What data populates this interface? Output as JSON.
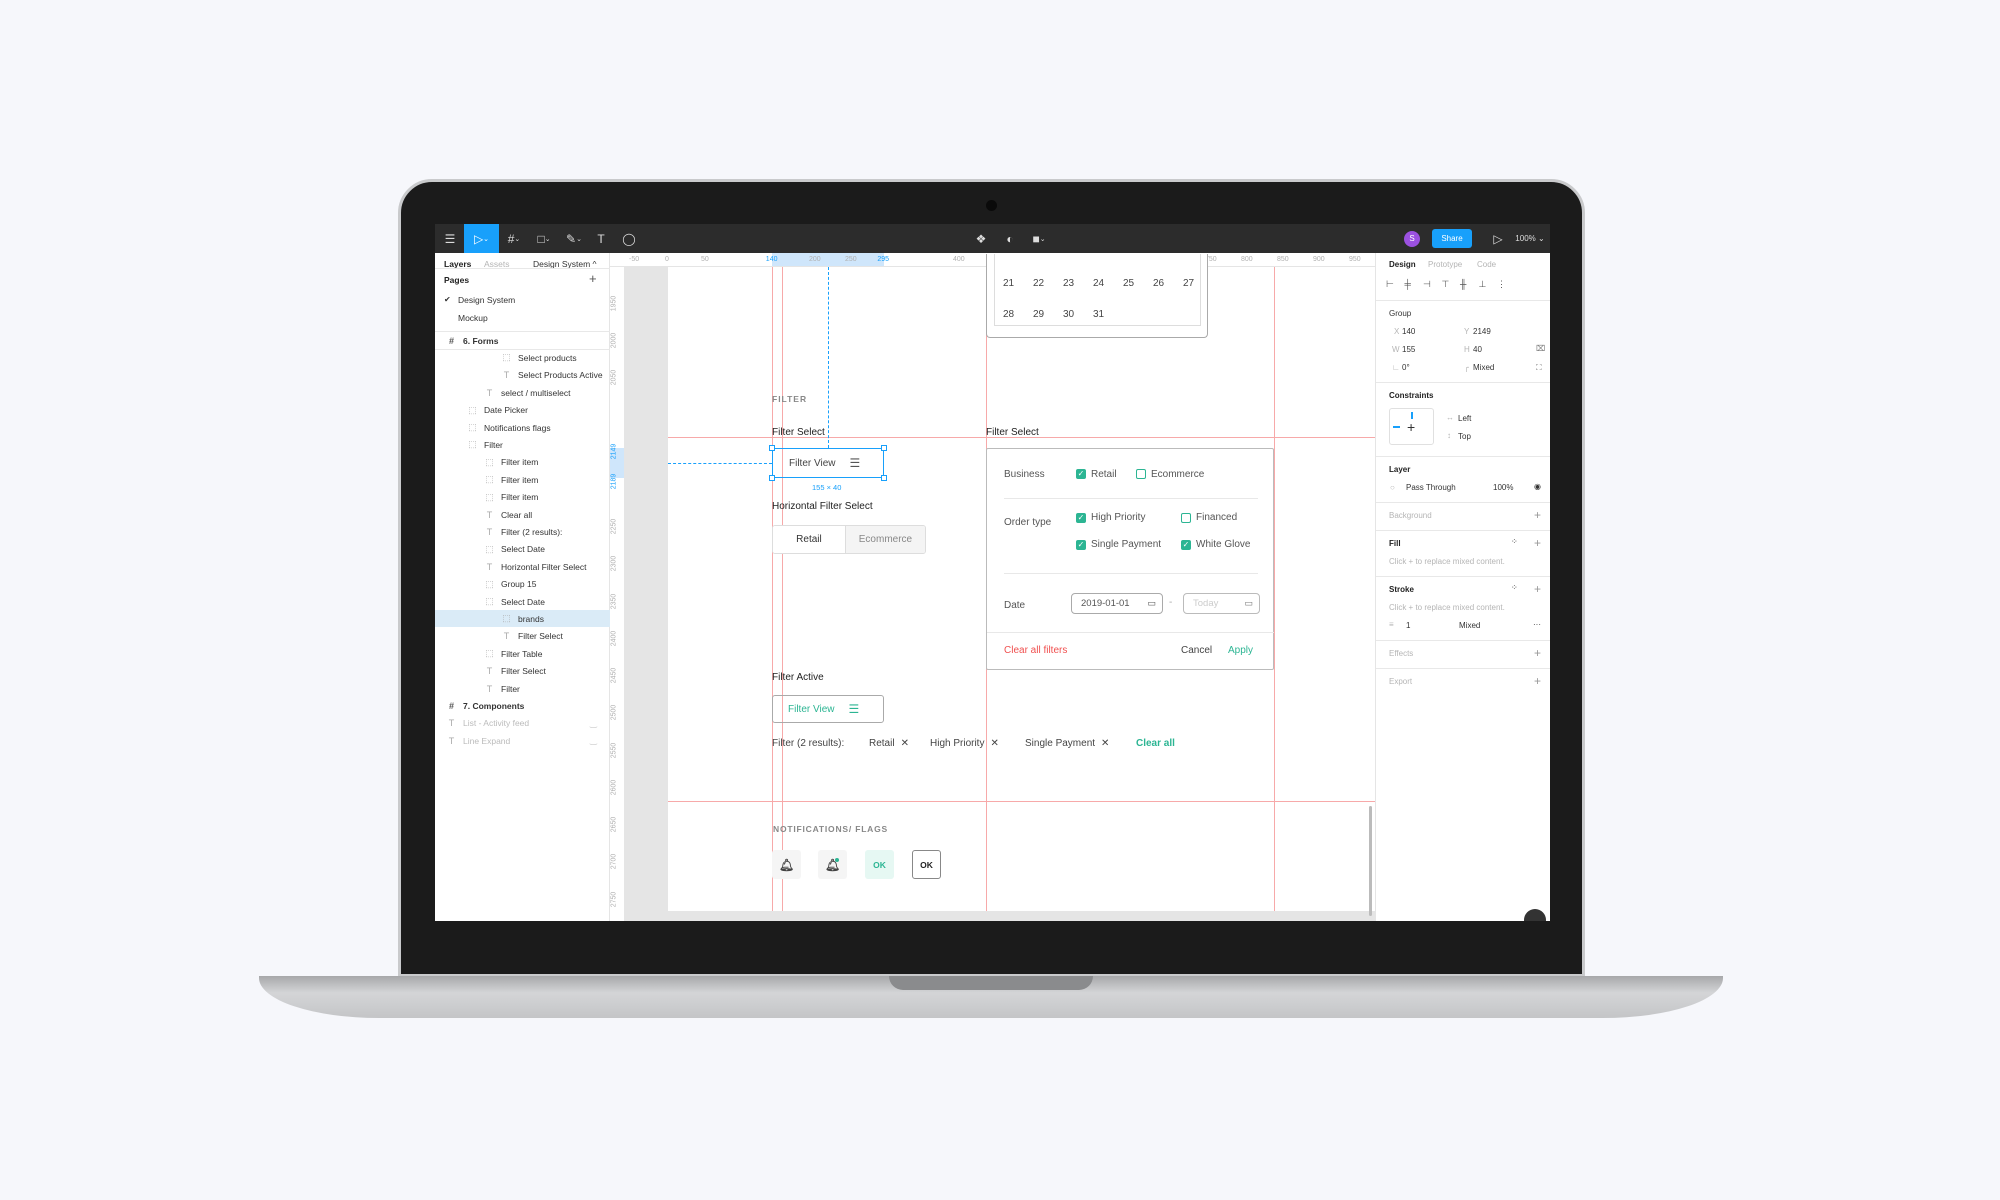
{
  "toolbar": {
    "zoom": "100%",
    "share": "Share",
    "avatar": "S",
    "icons": [
      "menu-icon",
      "move-icon",
      "frame-icon",
      "rectangle-icon",
      "pen-icon",
      "text-icon",
      "comment-icon",
      "component-icon",
      "mask-icon",
      "boolean-icon",
      "play-icon"
    ]
  },
  "left_panel": {
    "tabs": {
      "layers": "Layers",
      "assets": "Assets",
      "page_select": "Design System ^"
    },
    "pages_title": "Pages",
    "pages": [
      {
        "label": "Design System",
        "active": true
      },
      {
        "label": "Mockup",
        "active": false
      }
    ],
    "layers": [
      {
        "label": "6. Forms",
        "type": "frame",
        "level": 0
      },
      {
        "label": "Select products",
        "type": "group",
        "level": 3
      },
      {
        "label": "Select Products Active",
        "type": "text",
        "level": 3
      },
      {
        "label": "select / multiselect",
        "type": "text",
        "level": 2
      },
      {
        "label": "Date Picker",
        "type": "group",
        "level": 1
      },
      {
        "label": "Notifications flags",
        "type": "group",
        "level": 1
      },
      {
        "label": "Filter",
        "type": "group",
        "level": 1
      },
      {
        "label": "Filter item",
        "type": "group",
        "level": 2
      },
      {
        "label": "Filter item",
        "type": "group",
        "level": 2
      },
      {
        "label": "Filter item",
        "type": "group",
        "level": 2
      },
      {
        "label": "Clear all",
        "type": "text",
        "level": 2
      },
      {
        "label": "Filter (2 results):",
        "type": "text",
        "level": 2
      },
      {
        "label": "Select Date",
        "type": "group",
        "level": 2
      },
      {
        "label": "Horizontal Filter Select",
        "type": "text",
        "level": 2
      },
      {
        "label": "Group 15",
        "type": "group",
        "level": 2
      },
      {
        "label": "Select Date",
        "type": "group",
        "level": 2
      },
      {
        "label": "brands",
        "type": "group",
        "level": 3,
        "selected": true
      },
      {
        "label": "Filter Select",
        "type": "text",
        "level": 3
      },
      {
        "label": "Filter Table",
        "type": "group",
        "level": 2
      },
      {
        "label": "Filter Select",
        "type": "text",
        "level": 2
      },
      {
        "label": "Filter",
        "type": "text",
        "level": 2
      },
      {
        "label": "7. Components",
        "type": "frame",
        "level": 0
      },
      {
        "label": "List - Activity feed",
        "type": "text",
        "level": 0,
        "hidden": true
      },
      {
        "label": "Line Expand",
        "type": "text",
        "level": 0,
        "hidden": true
      }
    ]
  },
  "rulers": {
    "top": [
      "-50",
      "0",
      "50",
      "140",
      "200",
      "250",
      "295",
      "400",
      "450",
      "500",
      "550",
      "600",
      "650",
      "700",
      "750",
      "800",
      "850",
      "900",
      "950"
    ],
    "top_highlight": [
      "140",
      "295"
    ],
    "left": [
      "1950",
      "2000",
      "2050",
      "2149",
      "2189",
      "2250",
      "2300",
      "2350",
      "2400",
      "2450",
      "2500",
      "2550",
      "2600",
      "2650",
      "2700",
      "2750"
    ],
    "left_highlight": [
      "2149",
      "2189"
    ]
  },
  "canvas": {
    "calendar": {
      "rows": [
        [
          "21",
          "22",
          "23",
          "24",
          "25",
          "26",
          "27"
        ],
        [
          "28",
          "29",
          "30",
          "31"
        ]
      ]
    },
    "section_filter": "FILTER",
    "filter_select_title": "Filter Select",
    "filter_view_label": "Filter View",
    "selection_size": "155 × 40",
    "horizontal_title": "Horizontal Filter Select",
    "segments": [
      {
        "label": "Retail",
        "active": true
      },
      {
        "label": "Ecommerce",
        "active": false
      }
    ],
    "panel": {
      "title": "Filter Select",
      "business_label": "Business",
      "business": [
        {
          "label": "Retail",
          "checked": true
        },
        {
          "label": "Ecommerce",
          "checked": false
        }
      ],
      "order_label": "Order type",
      "order": [
        {
          "label": "High Priority",
          "checked": true
        },
        {
          "label": "Financed",
          "checked": false
        },
        {
          "label": "Single Payment",
          "checked": true
        },
        {
          "label": "White Glove",
          "checked": true
        }
      ],
      "date_label": "Date",
      "date_from": "2019-01-01",
      "date_to_placeholder": "Today",
      "date_sep": "-",
      "clear": "Clear all filters",
      "cancel": "Cancel",
      "apply": "Apply"
    },
    "filter_active_title": "Filter Active",
    "results_label": "Filter (2 results):",
    "chips": [
      "Retail",
      "High Priority",
      "Single Payment"
    ],
    "clear_all": "Clear all",
    "notifications_title": "NOTIFICATIONS/ FLAGS",
    "flags": [
      {
        "type": "bell"
      },
      {
        "type": "bell-dot"
      },
      {
        "type": "ok-filled",
        "label": "OK"
      },
      {
        "type": "ok-outline",
        "label": "OK"
      }
    ]
  },
  "right_panel": {
    "tabs": [
      "Design",
      "Prototype",
      "Code"
    ],
    "group_label": "Group",
    "x_label": "X",
    "x": "140",
    "y_label": "Y",
    "y": "2149",
    "w_label": "W",
    "w": "155",
    "h_label": "H",
    "h": "40",
    "rotation": "0°",
    "radius": "Mixed",
    "constraints_title": "Constraints",
    "constraint_h": "Left",
    "constraint_v": "Top",
    "layer_title": "Layer",
    "blend": "Pass Through",
    "opacity": "100%",
    "background_title": "Background",
    "fill_title": "Fill",
    "fill_hint": "Click + to replace mixed content.",
    "stroke_title": "Stroke",
    "stroke_hint": "Click + to replace mixed content.",
    "stroke_width": "1",
    "stroke_align": "Mixed",
    "effects_title": "Effects",
    "export_title": "Export"
  },
  "colors": {
    "accent": "#18a0fb",
    "teal": "#2cb593",
    "danger": "#f0504f",
    "avatar": "#9b51e0",
    "toolbar": "#2c2c2c"
  }
}
